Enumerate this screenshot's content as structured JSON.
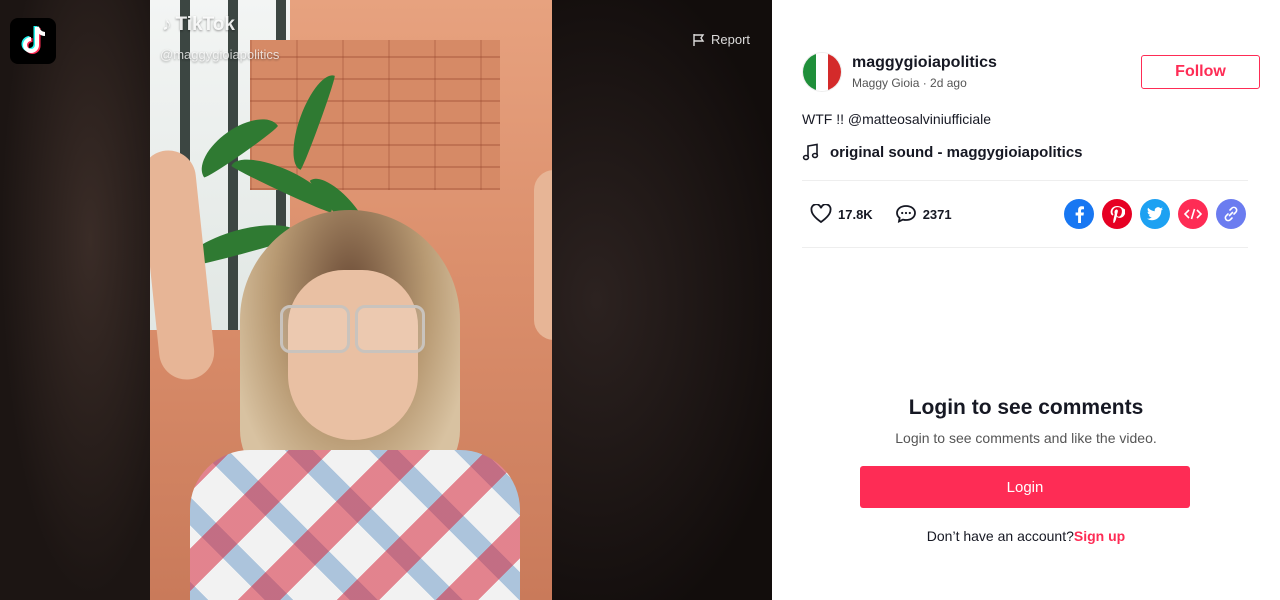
{
  "stage": {
    "logo_icon": "tiktok-logo-icon",
    "watermark_brand": "TikTok",
    "watermark_handle": "@maggygioiapolitics",
    "report_label": "Report"
  },
  "author": {
    "unique_id": "maggygioiapolitics",
    "nickname": "Maggy Gioia",
    "separator": " · ",
    "time_ago": "2d ago",
    "avatar_colors": [
      "#1f8f3a",
      "#ffffff",
      "#d42a2a"
    ],
    "follow_label": "Follow"
  },
  "video": {
    "description_prefix": "WTF !! ",
    "mention": "@matteosalviniufficiale",
    "music_title": "original sound - maggygioiapolitics",
    "likes": "17.8K",
    "comments": "2371"
  },
  "share": {
    "icons": [
      "facebook-icon",
      "pinterest-icon",
      "twitter-icon",
      "embed-icon",
      "copy-link-icon"
    ],
    "colors": {
      "facebook": "#1877f2",
      "pinterest": "#e60023",
      "twitter": "#1da1f2",
      "embed": "#fe2c55",
      "link": "#6b7cf0"
    }
  },
  "comments_gate": {
    "title": "Login to see comments",
    "subtitle": "Login to see comments and like the video.",
    "login_label": "Login",
    "signup_prompt": "Don’t have an account?",
    "signup_label": "Sign up"
  },
  "colors": {
    "brand": "#fe2c55",
    "text": "#161823"
  }
}
